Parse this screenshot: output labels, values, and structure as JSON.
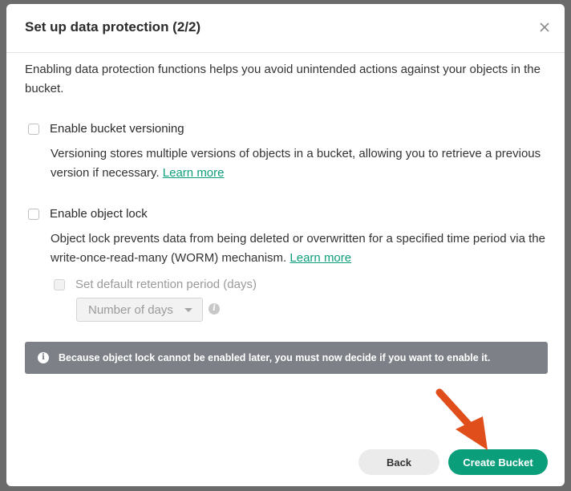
{
  "modal": {
    "title": "Set up data protection (2/2)",
    "close_icon": "close-icon",
    "intro": "Enabling data protection functions helps you avoid unintended actions against your objects in the bucket."
  },
  "versioning": {
    "checked": false,
    "label": "Enable bucket versioning",
    "description": "Versioning stores multiple versions of objects in a bucket, allowing you to retrieve a previous version if necessary.",
    "link": "Learn more"
  },
  "object_lock": {
    "checked": false,
    "label": "Enable object lock",
    "description": "Object lock prevents data from being deleted or overwritten for a specified time period via the write-once-read-many (WORM) mechanism.",
    "link": "Learn more",
    "retention": {
      "checked": false,
      "disabled": true,
      "label": "Set default retention period (days)",
      "select_placeholder": "Number of days",
      "info_icon": "info-icon"
    }
  },
  "alert": {
    "icon": "info-icon",
    "text": "Because object lock cannot be enabled later, you must now decide if you want to enable it."
  },
  "footer": {
    "back_label": "Back",
    "create_label": "Create Bucket"
  },
  "colors": {
    "primary": "#0a9e7a",
    "link": "#0e9e7b",
    "alert_bg": "#7d8087",
    "annotation_arrow": "#e04e1c"
  }
}
